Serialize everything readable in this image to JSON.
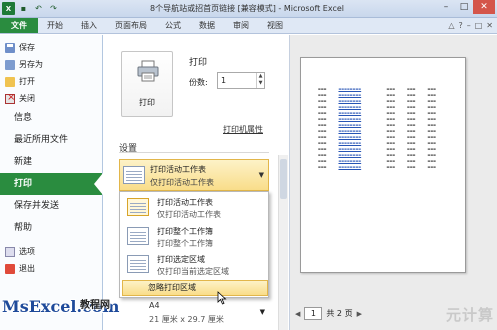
{
  "titlebar": {
    "title": "8个导航站或招首页链接 [兼容模式] - Microsoft Excel",
    "quick_access": [
      "excel-app-icon",
      "save-icon",
      "undo-icon",
      "redo-icon"
    ],
    "controls": {
      "minimize": "–",
      "maximize": "□",
      "close": "✕"
    }
  },
  "ribbon": {
    "tabs": [
      "文件",
      "开始",
      "插入",
      "页面布局",
      "公式",
      "数据",
      "审阅",
      "视图"
    ],
    "active_tab": "文件",
    "right_icons": [
      "minimize-ribbon-icon",
      "help-icon"
    ],
    "right_glyphs": {
      "collapse": "△",
      "help": "?",
      "minimize": "–",
      "restore": "□",
      "close": "✕"
    }
  },
  "backstage_nav": {
    "small_items": [
      {
        "label": "保存",
        "icon": "save-icon"
      },
      {
        "label": "另存为",
        "icon": "save-as-icon"
      },
      {
        "label": "打开",
        "icon": "open-icon"
      },
      {
        "label": "关闭",
        "icon": "close-file-icon"
      }
    ],
    "big_items": [
      "信息",
      "最近所用文件",
      "新建",
      "打印",
      "保存并发送",
      "帮助"
    ],
    "active": "打印",
    "bottom_items": [
      {
        "label": "选项",
        "icon": "options-icon"
      },
      {
        "label": "退出",
        "icon": "exit-icon"
      }
    ]
  },
  "print_panel": {
    "heading": "打印",
    "print_button_label": "打印",
    "copies_label": "份数:",
    "copies_value": "1",
    "printer_properties_link": "打印机属性",
    "settings_heading": "设置",
    "scope_dropdown": {
      "title": "打印活动工作表",
      "subtitle": "仅打印活动工作表"
    },
    "scope_options": [
      {
        "title": "打印活动工作表",
        "subtitle": "仅打印活动工作表"
      },
      {
        "title": "打印整个工作簿",
        "subtitle": "打印整个工作簿"
      },
      {
        "title": "打印选定区域",
        "subtitle": "仅打印当前选定区域"
      }
    ],
    "ignore_print_area": "忽略打印区域",
    "paper": {
      "name": "A4",
      "size": "21 厘米 x 29.7 厘米"
    }
  },
  "preview": {
    "current_page": "1",
    "page_total": "共 2 页",
    "mini_table_rows": 14
  },
  "watermarks": {
    "left_brand": "MsExcel.com",
    "left_cn": "教程网",
    "right": "元计算"
  },
  "colors": {
    "file_tab": "#2a8c3f",
    "active_nav": "#2a8c3f",
    "dropdown_highlight": "#f9dd8a"
  }
}
